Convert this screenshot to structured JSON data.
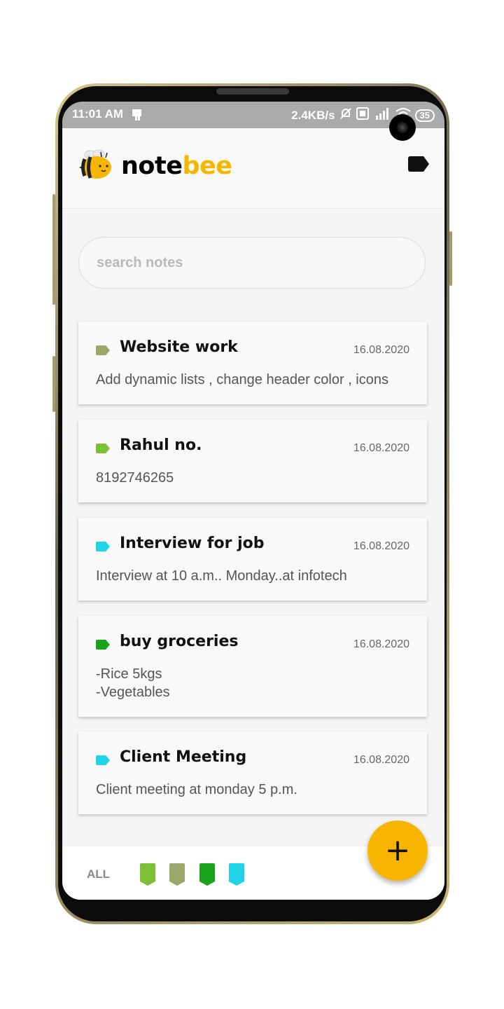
{
  "status_bar": {
    "time": "11:01 AM",
    "net_speed": "2.4KB/s",
    "battery": "35"
  },
  "app": {
    "logo_part1": "note",
    "logo_part2": "bee",
    "accent_color": "#f7b500"
  },
  "search": {
    "placeholder": "search notes",
    "value": ""
  },
  "notes": [
    {
      "title": "Website work",
      "date": "16.08.2020",
      "body": "Add dynamic lists , change header color , icons",
      "tag_color": "#9aa869"
    },
    {
      "title": "Rahul no.",
      "date": "16.08.2020",
      "body": "8192746265",
      "tag_color": "#7cc036"
    },
    {
      "title": "Interview for job",
      "date": "16.08.2020",
      "body": "Interview at 10 a.m.. Monday..at infotech",
      "tag_color": "#1ed4e6"
    },
    {
      "title": "buy groceries",
      "date": "16.08.2020",
      "body": "-Rice 5kgs\n-Vegetables",
      "tag_color": "#1aa21a"
    },
    {
      "title": "Client Meeting",
      "date": "16.08.2020",
      "body": "Client meeting at monday 5 p.m.",
      "tag_color": "#1ed4e6"
    }
  ],
  "bottom_bar": {
    "all_label": "ALL",
    "filters": [
      {
        "icon": "tag-filter-icon",
        "color": "#7cc036"
      },
      {
        "icon": "tag-filter-icon",
        "color": "#9aa869"
      },
      {
        "icon": "tag-filter-icon",
        "color": "#1aa21a"
      },
      {
        "icon": "tag-filter-icon",
        "color": "#1ed4e6"
      }
    ],
    "fab_label": "+"
  }
}
